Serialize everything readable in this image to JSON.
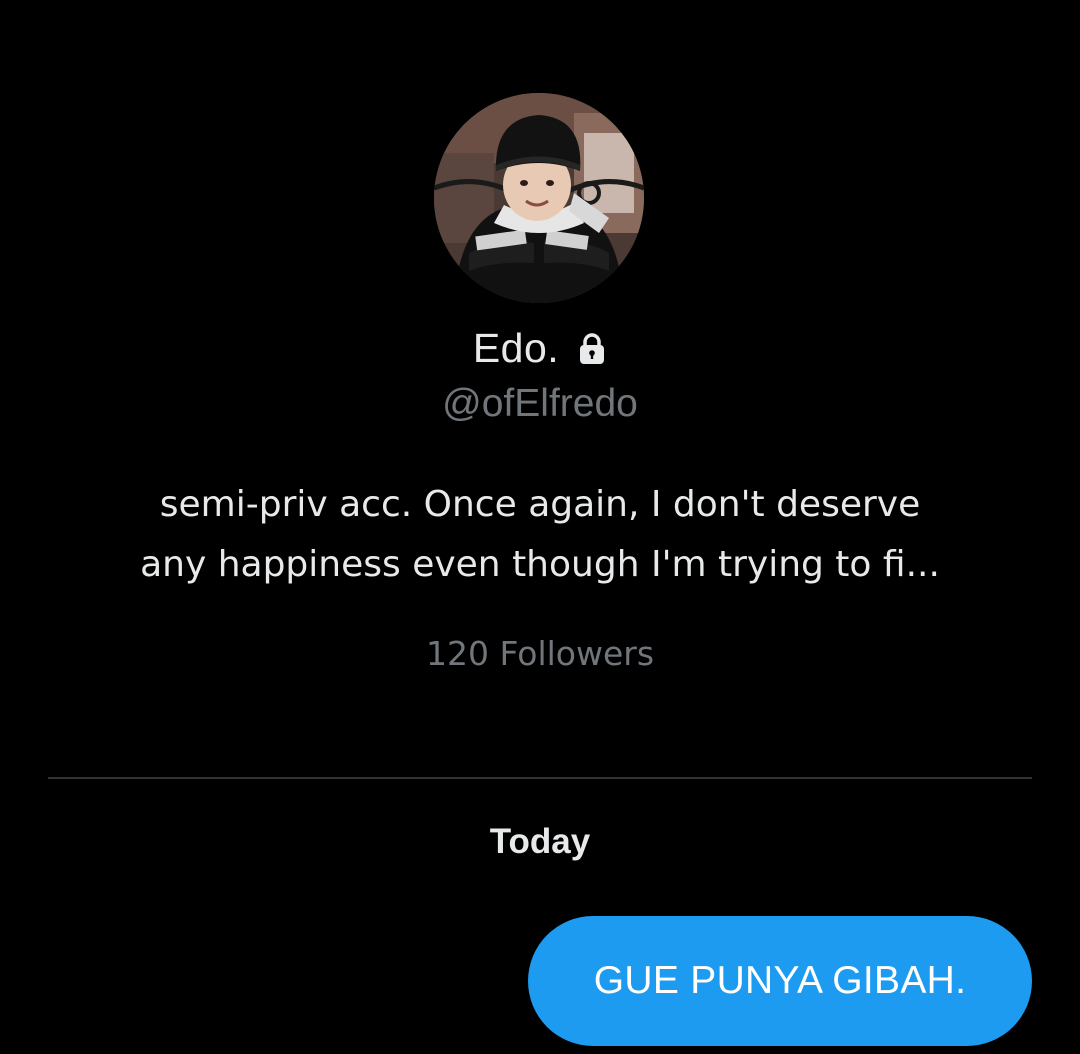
{
  "profile": {
    "display_name": "Edo.",
    "protected_icon": "lock-icon",
    "handle": "@ofElfredo",
    "bio_lines": [
      "semi-priv acc. Once again, I don't deserve",
      "any happiness even though I'm trying to fi..."
    ],
    "followers": "120 Followers"
  },
  "conversation": {
    "date_separator": "Today",
    "messages": [
      {
        "text": "GUE PUNYA GIBAH.",
        "direction": "sent"
      }
    ]
  },
  "colors": {
    "background": "#000000",
    "primary_text": "#e7e9ea",
    "secondary_text": "#71767b",
    "divider": "#2f3336",
    "sent_bubble": "#1d9bf0"
  }
}
